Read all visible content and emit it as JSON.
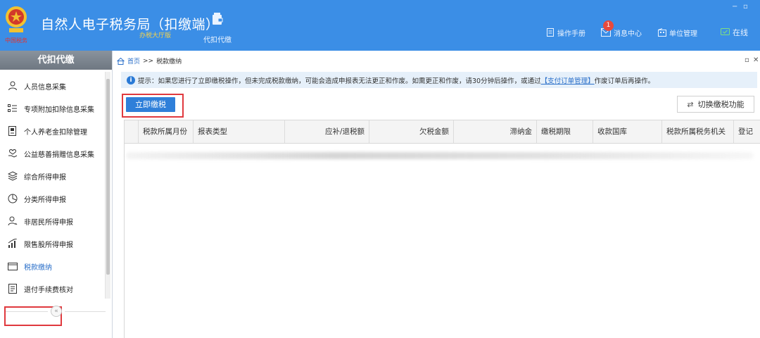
{
  "header": {
    "title": "自然人电子税务局（扣缴端）",
    "subtitle": "办税大厅版",
    "emblem_text": "中国税务",
    "nav_tab_label": "代扣代缴",
    "tools": [
      {
        "label": "操作手册",
        "icon": "document-icon"
      },
      {
        "label": "消息中心",
        "icon": "mail-icon",
        "badge": "1"
      },
      {
        "label": "单位管理",
        "icon": "building-icon"
      },
      {
        "label": "在线",
        "icon": "online-icon"
      }
    ],
    "window_controls": [
      "−",
      "▫"
    ],
    "bg_color": "#3b8ee6",
    "subtitle_color": "#f5d24a"
  },
  "sidebar": {
    "title": "代扣代缴",
    "items": [
      {
        "label": "人员信息采集",
        "icon": "person-icon"
      },
      {
        "label": "专项附加扣除信息采集",
        "icon": "list-icon"
      },
      {
        "label": "个人养老金扣除管理",
        "icon": "pension-icon"
      },
      {
        "label": "公益慈善捐赠信息采集",
        "icon": "donation-icon"
      },
      {
        "label": "综合所得申报",
        "icon": "layers-icon"
      },
      {
        "label": "分类所得申报",
        "icon": "pie-icon"
      },
      {
        "label": "非居民所得申报",
        "icon": "user-icon"
      },
      {
        "label": "限售股所得申报",
        "icon": "bar-chart-icon"
      },
      {
        "label": "税款缴纳",
        "icon": "folder-icon",
        "active": true
      },
      {
        "label": "退付手续费核对",
        "icon": "receipt-icon"
      }
    ],
    "collapse_glyph": "«"
  },
  "main": {
    "breadcrumb": {
      "home": "首页",
      "separator": ">>",
      "current": "税款缴纳"
    },
    "panel_controls": [
      "▫",
      "✕"
    ],
    "notice": {
      "prefix": "提示：如果您进行了立即缴税操作，但未完成税款缴纳，可能会造成申报表无法更正和作废。如需更正和作废，请30分钟后操作，或通过",
      "link": "【支付订单管理】",
      "suffix": "作废订单后再操作。"
    },
    "pay_button": "立即缴税",
    "switch_button": "切换缴税功能",
    "table": {
      "columns": [
        "",
        "税款所属月份",
        "报表类型",
        "应补/退税额",
        "欠税金额",
        "滞纳金",
        "缴税期限",
        "收款国库",
        "税款所属税务机关",
        "登记"
      ]
    }
  },
  "colors": {
    "accent": "#2f7fd9",
    "highlight_box": "#e0393e",
    "notice_bg": "#e6f0fa"
  }
}
